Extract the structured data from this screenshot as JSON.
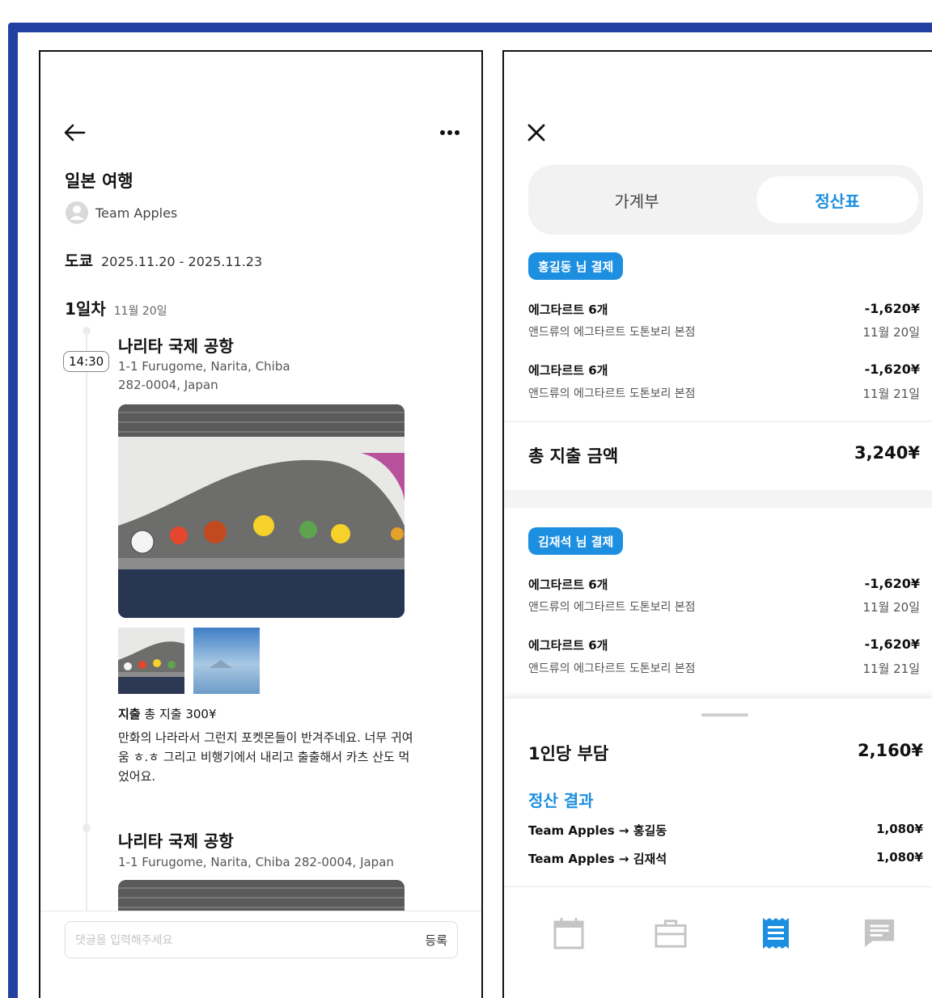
{
  "left": {
    "trip_title": "일본 여행",
    "team_name": "Team Apples",
    "city": "도쿄",
    "date_range": "2025.11.20 - 2025.11.23",
    "day_label": "1일차",
    "day_date": "11월 20일",
    "place1": {
      "time": "14:30",
      "title": "나리타 국제 공항",
      "address_line1": "1-1 Furugome, Narita, Chiba",
      "address_line2": "282-0004, Japan"
    },
    "expense": {
      "label": "지출",
      "total": "총 지출 300¥"
    },
    "memo": "만화의 나라라서 그런지 포켓몬들이 반겨주네요. 너무 귀여움 ㅎ.ㅎ 그리고 비행기에서 내리고 출출해서 카츠 산도 먹었어요.",
    "place2": {
      "title": "나리타 국제 공항",
      "address": "1-1 Furugome, Narita, Chiba 282-0004, Japan"
    },
    "comment_placeholder": "댓글을 입력해주세요",
    "comment_submit": "등록",
    "icons": {
      "back": "arrow-left-icon",
      "more": "more-horizontal-icon",
      "avatar": "user-avatar-icon"
    }
  },
  "right": {
    "tabs": {
      "ledger": "가계부",
      "settlement": "정산표"
    },
    "group1": {
      "badge": "홍길동 님 결제",
      "items": [
        {
          "title": "에그타르트 6개",
          "store": "앤드류의 에그타르트 도톤보리 본점",
          "amount": "-1,620¥",
          "date": "11월 20일"
        },
        {
          "title": "에그타르트 6개",
          "store": "앤드류의 에그타르트 도톤보리 본점",
          "amount": "-1,620¥",
          "date": "11월 21일"
        }
      ]
    },
    "total_label": "총 지출 금액",
    "total_value": "3,240¥",
    "group2": {
      "badge": "김재석 님 결제",
      "items": [
        {
          "title": "에그타르트 6개",
          "store": "앤드류의 에그타르트 도톤보리 본점",
          "amount": "-1,620¥",
          "date": "11월 20일"
        },
        {
          "title": "에그타르트 6개",
          "store": "앤드류의 에그타르트 도톤보리 본점",
          "amount": "-1,620¥",
          "date": "11월 21일"
        }
      ]
    },
    "per_person_label": "1인당 부담",
    "per_person_value": "2,160¥",
    "result_title": "정산 결과",
    "results": [
      {
        "name": "Team Apples → 홍길동",
        "amount": "1,080¥"
      },
      {
        "name": "Team Apples → 김재석",
        "amount": "1,080¥"
      }
    ],
    "nav": [
      "calendar-icon",
      "briefcase-icon",
      "receipt-icon",
      "chat-icon"
    ],
    "accent_color": "#1d8fe1"
  }
}
